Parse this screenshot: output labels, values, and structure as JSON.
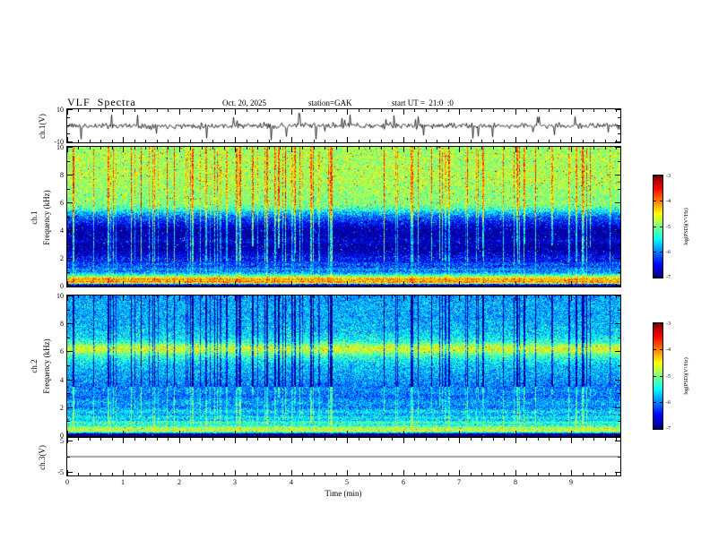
{
  "header": {
    "title": "VLF  Spectra",
    "date": "Oct. 20, 2025",
    "station": "station=GAK",
    "start_ut": "start UT =  21:0  :0"
  },
  "xaxis": {
    "label": "Time (min)",
    "min": 0,
    "max": 9.88,
    "ticks": [
      0,
      1,
      2,
      3,
      4,
      5,
      6,
      7,
      8,
      9
    ],
    "minor_step": 0.2
  },
  "colors": {
    "foreground": "#000000",
    "background": "#ffffff",
    "colormap": "jet"
  },
  "chart_data": [
    {
      "type": "line",
      "name": "ch1_waveform",
      "ylabel": "ch.1(V)",
      "ylim": [
        -10,
        10
      ],
      "yticks": [
        10,
        -10
      ],
      "yticks_minor": [
        5,
        0,
        -5
      ],
      "baseline": 0,
      "noise_amp": 1.7,
      "spike_count": 30,
      "spike_amp_range": [
        3,
        9
      ],
      "description": "broadband noisy voltage trace around 0 V with impulsive spikes reaching about ±9 V"
    },
    {
      "type": "heatmap",
      "name": "ch1_spectrogram",
      "ylabel": "ch.1",
      "ylabel2": "Frequency (kHz)",
      "ylim": [
        0,
        10
      ],
      "yticks": [
        0,
        2,
        4,
        6,
        8,
        10
      ],
      "yticks_minor": [
        1,
        3,
        5,
        7,
        9
      ],
      "value_label": "log(PSD)(V²/Hz)",
      "value_range": [
        -7,
        -3
      ],
      "noise": 0.75,
      "spark_prob": 0.02,
      "spark_amp": 1.7,
      "freq_profile": [
        [
          0,
          -7
        ],
        [
          0.1,
          -6.8
        ],
        [
          0.2,
          -4.6
        ],
        [
          0.3,
          -4.0
        ],
        [
          0.4,
          -4.3
        ],
        [
          0.5,
          -4.1
        ],
        [
          0.6,
          -4.6
        ],
        [
          0.75,
          -5.1
        ],
        [
          0.9,
          -5.7
        ],
        [
          1.05,
          -6.1
        ],
        [
          1.2,
          -5.9
        ],
        [
          1.4,
          -6.3
        ],
        [
          1.6,
          -6.15
        ],
        [
          1.8,
          -6.5
        ],
        [
          2.0,
          -6.45
        ],
        [
          2.3,
          -6.7
        ],
        [
          2.6,
          -6.85
        ],
        [
          3.0,
          -6.9
        ],
        [
          3.25,
          -6.65
        ],
        [
          3.5,
          -6.85
        ],
        [
          3.8,
          -6.9
        ],
        [
          4.1,
          -6.85
        ],
        [
          4.4,
          -6.6
        ],
        [
          4.7,
          -6.35
        ],
        [
          5.0,
          -6.1
        ],
        [
          5.3,
          -5.7
        ],
        [
          5.6,
          -5.2
        ],
        [
          5.9,
          -5.0
        ],
        [
          6.3,
          -4.95
        ],
        [
          6.8,
          -4.9
        ],
        [
          7.3,
          -4.85
        ],
        [
          7.8,
          -4.8
        ],
        [
          8.3,
          -4.8
        ],
        [
          8.8,
          -4.85
        ],
        [
          9.3,
          -4.8
        ],
        [
          10,
          -4.9
        ]
      ],
      "streak_bands": [
        {
          "f0": 0,
          "f1": 1.8,
          "gain": 0.35
        },
        {
          "f0": 1.8,
          "f1": 5.5,
          "gain": 1.15
        },
        {
          "f0": 5.5,
          "f1": 10.01,
          "gain": 0.8
        }
      ],
      "description": "0-10 kHz spectrogram: bright green/yellow band 6-10 kHz with red specks, dark blue/black 2-5 kHz, bright narrow lines below 0.7 kHz, dense vertical sferic streaks"
    },
    {
      "type": "heatmap",
      "name": "ch2_spectrogram",
      "ylabel": "ch.2",
      "ylabel2": "Frequency (kHz)",
      "ylim": [
        0,
        10
      ],
      "yticks": [
        0,
        2,
        4,
        6,
        8,
        10
      ],
      "yticks_minor": [
        1,
        3,
        5,
        7,
        9
      ],
      "value_label": "log(PSD)(V²/Hz)",
      "value_range": [
        -7,
        -3
      ],
      "noise": 0.7,
      "spark_prob": 0.02,
      "spark_amp": 1.4,
      "freq_profile": [
        [
          0,
          -7
        ],
        [
          0.12,
          -6.9
        ],
        [
          0.22,
          -5.5
        ],
        [
          0.32,
          -4.65
        ],
        [
          0.42,
          -4.9
        ],
        [
          0.52,
          -4.7
        ],
        [
          0.65,
          -5.15
        ],
        [
          0.8,
          -5.5
        ],
        [
          0.95,
          -5.2
        ],
        [
          1.1,
          -5.75
        ],
        [
          1.3,
          -5.5
        ],
        [
          1.5,
          -5.9
        ],
        [
          1.7,
          -5.6
        ],
        [
          2.0,
          -6.0
        ],
        [
          2.4,
          -5.85
        ],
        [
          2.8,
          -6.1
        ],
        [
          3.2,
          -5.95
        ],
        [
          3.6,
          -6.05
        ],
        [
          4.0,
          -5.9
        ],
        [
          4.5,
          -5.8
        ],
        [
          5.0,
          -5.7
        ],
        [
          5.5,
          -5.45
        ],
        [
          5.85,
          -5.05
        ],
        [
          6.15,
          -4.6
        ],
        [
          6.4,
          -4.75
        ],
        [
          6.7,
          -5.35
        ],
        [
          7.1,
          -5.6
        ],
        [
          7.6,
          -5.75
        ],
        [
          8.1,
          -5.8
        ],
        [
          8.6,
          -5.85
        ],
        [
          9.1,
          -5.8
        ],
        [
          9.6,
          -5.85
        ],
        [
          10,
          -5.9
        ]
      ],
      "streak_bands": [
        {
          "f0": 0,
          "f1": 0.8,
          "gain": 0.15
        },
        {
          "f0": 0.8,
          "f1": 3.5,
          "gain": 0.55
        },
        {
          "f0": 3.5,
          "f1": 10.01,
          "gain": -1.15
        }
      ],
      "description": "0-10 kHz spectrogram: blue/cyan speckled background, bright green-yellow band near 6.2 kHz, bright narrow lines below 0.7 kHz, dark vertical sferic streaks above ~3.5 kHz"
    },
    {
      "type": "line",
      "name": "ch3_waveform",
      "ylabel": "ch.3(V)",
      "ylim": [
        -6,
        6
      ],
      "yticks": [
        5,
        -5
      ],
      "yticks_minor": [
        0
      ],
      "baseline": 0,
      "noise_amp": 0,
      "spike_count": 0,
      "spike_amp_range": [
        0,
        0
      ],
      "description": "flat line at 0 V (no signal)"
    }
  ],
  "colorbars": [
    {
      "label": "log(PSD)(V²/Hz)",
      "min": -7,
      "max": -3,
      "ticks": [
        -3,
        -4,
        -5,
        -6,
        -7
      ]
    },
    {
      "label": "log(PSD)(V²/Hz)",
      "min": -7,
      "max": -3,
      "ticks": [
        -3,
        -4,
        -5,
        -6,
        -7
      ]
    }
  ]
}
